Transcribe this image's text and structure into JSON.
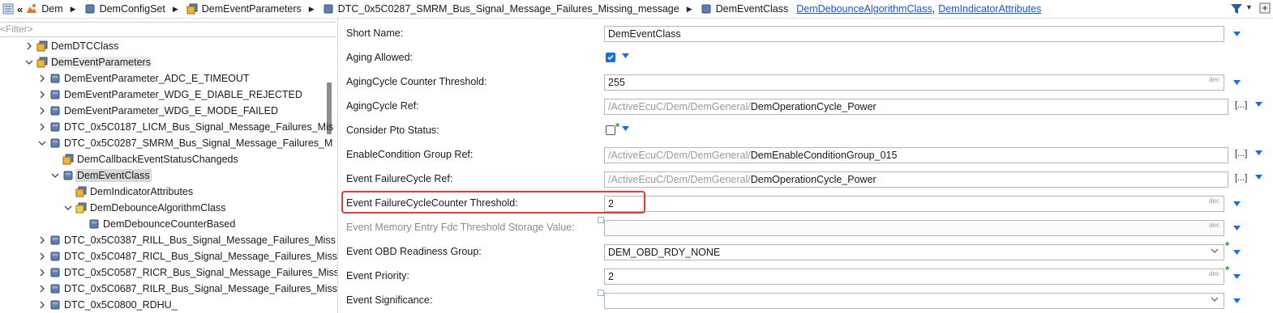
{
  "breadcrumb": {
    "items": [
      "Dem",
      "DemConfigSet",
      "DemEventParameters",
      "DTC_0x5C0287_SMRM_Bus_Signal_Message_Failures_Missing_message",
      "DemEventClass"
    ],
    "links": [
      "DemDebounceAlgorithmClass",
      "DemIndicatorAttributes"
    ],
    "link_separator": ","
  },
  "tree": {
    "filter_placeholder": "<Filter>",
    "nodes": [
      {
        "label": "DemDTCClass",
        "expander": "collapsed",
        "icon": "folder-icon"
      },
      {
        "label": "DemEventParameters",
        "expander": "expanded",
        "icon": "folder-icon",
        "highlighted": true
      },
      {
        "label": "DemEventParameter_ADC_E_TIMEOUT",
        "expander": "collapsed",
        "icon": "container-icon"
      },
      {
        "label": "DemEventParameter_WDG_E_DIABLE_REJECTED",
        "expander": "collapsed",
        "icon": "container-icon"
      },
      {
        "label": "DemEventParameter_WDG_E_MODE_FAILED",
        "expander": "collapsed",
        "icon": "container-icon"
      },
      {
        "label": "DTC_0x5C0187_LICM_Bus_Signal_Message_Failures_Mis",
        "expander": "collapsed",
        "icon": "container-icon"
      },
      {
        "label": "DTC_0x5C0287_SMRM_Bus_Signal_Message_Failures_M",
        "expander": "expanded",
        "icon": "container-icon"
      },
      {
        "label": "DemCallbackEventStatusChangeds",
        "expander": "none",
        "icon": "folder-icon"
      },
      {
        "label": "DemEventClass",
        "expander": "expanded",
        "icon": "container-icon",
        "selected": true
      },
      {
        "label": "DemIndicatorAttributes",
        "expander": "none",
        "icon": "folder-icon"
      },
      {
        "label": "DemDebounceAlgorithmClass",
        "expander": "expanded",
        "icon": "choice-icon"
      },
      {
        "label": "DemDebounceCounterBased",
        "expander": "none",
        "icon": "container-icon"
      },
      {
        "label": "DTC_0x5C0387_RILL_Bus_Signal_Message_Failures_Miss",
        "expander": "collapsed",
        "icon": "container-icon"
      },
      {
        "label": "DTC_0x5C0487_RICL_Bus_Signal_Message_Failures_Miss",
        "expander": "collapsed",
        "icon": "container-icon"
      },
      {
        "label": "DTC_0x5C0587_RICR_Bus_Signal_Message_Failures_Miss",
        "expander": "collapsed",
        "icon": "container-icon"
      },
      {
        "label": "DTC_0x5C0687_RILR_Bus_Signal_Message_Failures_Miss",
        "expander": "collapsed",
        "icon": "container-icon"
      },
      {
        "label": "DTC_0x5C0800_RDHU_",
        "expander": "collapsed",
        "icon": "container-icon"
      }
    ]
  },
  "properties": [
    {
      "label": "Short Name:",
      "type": "text",
      "value": "DemEventClass"
    },
    {
      "label": "Aging Allowed:",
      "type": "checkbox",
      "checked": true
    },
    {
      "label": "AgingCycle Counter Threshold:",
      "type": "number",
      "value": "255",
      "unit": "dec"
    },
    {
      "label": "AgingCycle Ref:",
      "type": "ref",
      "path": "/ActiveEcuC/Dem/DemGeneral/",
      "value": "DemOperationCycle_Power",
      "browse": "[...]"
    },
    {
      "label": "Consider Pto Status:",
      "type": "checkbox",
      "checked": false,
      "modified_star": "*"
    },
    {
      "label": "EnableCondition Group Ref:",
      "type": "ref",
      "path": "/ActiveEcuC/Dem/DemGeneral/",
      "value": "DemEnableConditionGroup_015",
      "browse": "[...]"
    },
    {
      "label": "Event FailureCycle Ref:",
      "type": "ref",
      "path": "/ActiveEcuC/Dem/DemGeneral/",
      "value": "DemOperationCycle_Power",
      "browse": "[...]"
    },
    {
      "label": "Event FailureCycleCounter Threshold:",
      "type": "number",
      "value": "2",
      "unit": "dec",
      "highlighted": true
    },
    {
      "label": "Event Memory Entry Fdc Threshold Storage Value:",
      "type": "number",
      "value": "",
      "unit": "dec",
      "disabled": true
    },
    {
      "label": "Event OBD Readiness Group:",
      "type": "select",
      "value": "DEM_OBD_RDY_NONE",
      "modified_star": "*"
    },
    {
      "label": "Event Priority:",
      "type": "number",
      "value": "2",
      "unit": "dec",
      "modified_star": "*"
    },
    {
      "label": "Event Significance:",
      "type": "select",
      "value": ""
    }
  ],
  "colors": {
    "accent": "#1a6fd6",
    "link": "#1a56c8",
    "highlight_box": "#e03a3a",
    "modified_star": "#1e9e2a"
  }
}
